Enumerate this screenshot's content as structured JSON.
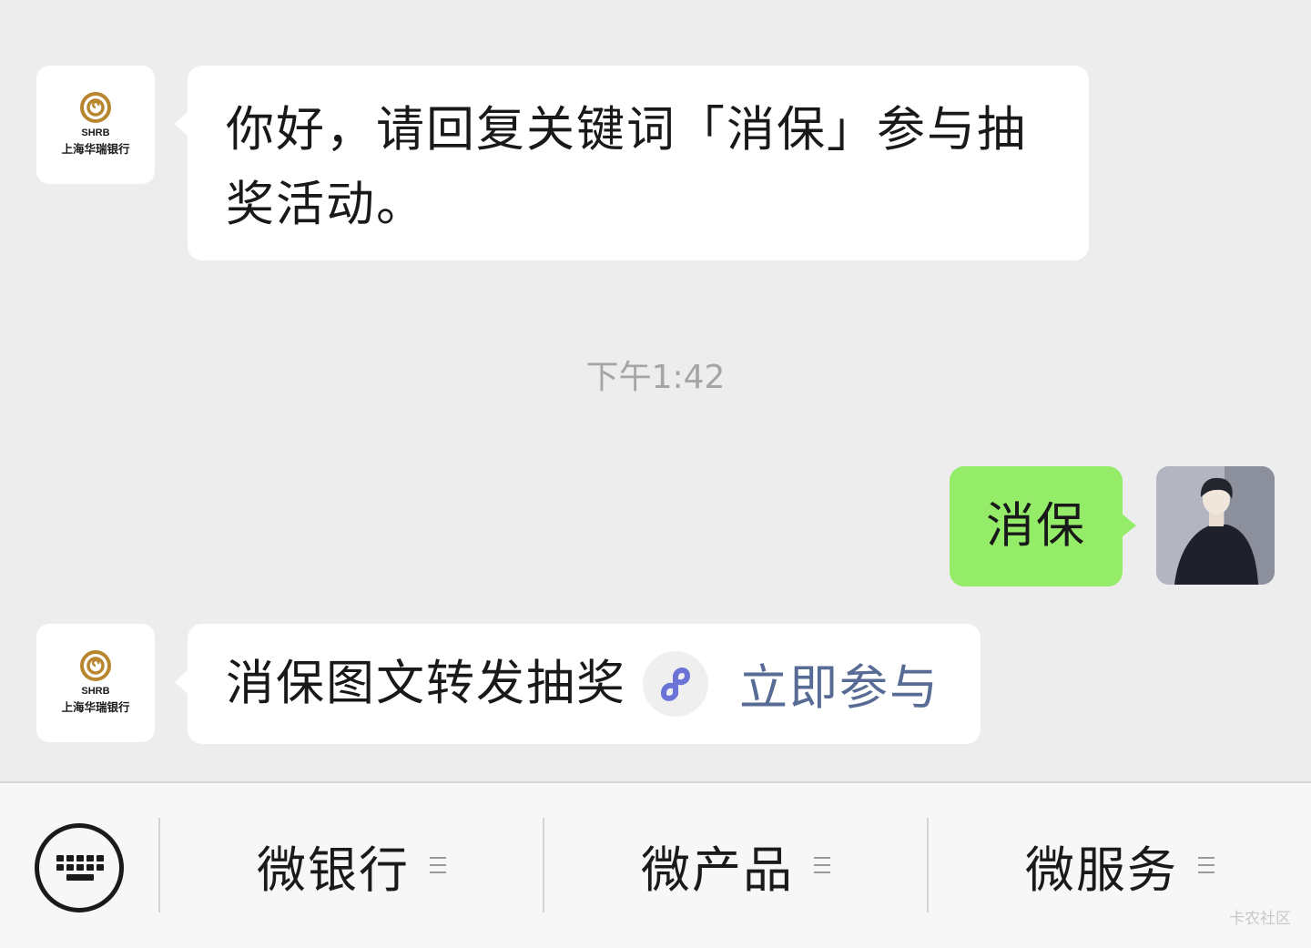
{
  "messages": [
    {
      "sender": "bank",
      "text_line1": "你好，请回复关键词「消保」参与抽",
      "text_line2": "奖活动。"
    },
    {
      "sender": "user",
      "text": "消保"
    },
    {
      "sender": "bank",
      "text": "消保图文转发抽奖",
      "link_icon": "mini-program-icon",
      "link_text": "立即参与"
    }
  ],
  "bank_logo": {
    "abbr": "SHRB",
    "name": "上海华瑞银行",
    "accent": "#b8862f"
  },
  "timestamp": "下午1:42",
  "menu": {
    "keyboard_icon": "keyboard-icon",
    "items": [
      {
        "label": "微银行"
      },
      {
        "label": "微产品"
      },
      {
        "label": "微服务"
      }
    ]
  },
  "watermark": "卡农社区",
  "colors": {
    "background": "#ededed",
    "user_bubble": "#95ec69",
    "link": "#576b95",
    "timestamp": "#a5a5a5"
  }
}
